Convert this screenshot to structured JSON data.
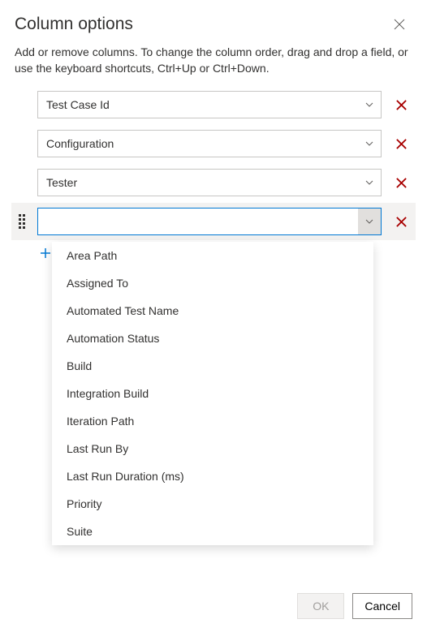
{
  "header": {
    "title": "Column options",
    "description": "Add or remove columns. To change the column order, drag and drop a field, or use the keyboard shortcuts, Ctrl+Up or Ctrl+Down."
  },
  "columns": [
    {
      "value": "Test Case Id"
    },
    {
      "value": "Configuration"
    },
    {
      "value": "Tester"
    }
  ],
  "dropdown_options": [
    "Area Path",
    "Assigned To",
    "Automated Test Name",
    "Automation Status",
    "Build",
    "Integration Build",
    "Iteration Path",
    "Last Run By",
    "Last Run Duration (ms)",
    "Priority",
    "Suite"
  ],
  "footer": {
    "ok_label": "OK",
    "cancel_label": "Cancel"
  },
  "active_input_value": ""
}
